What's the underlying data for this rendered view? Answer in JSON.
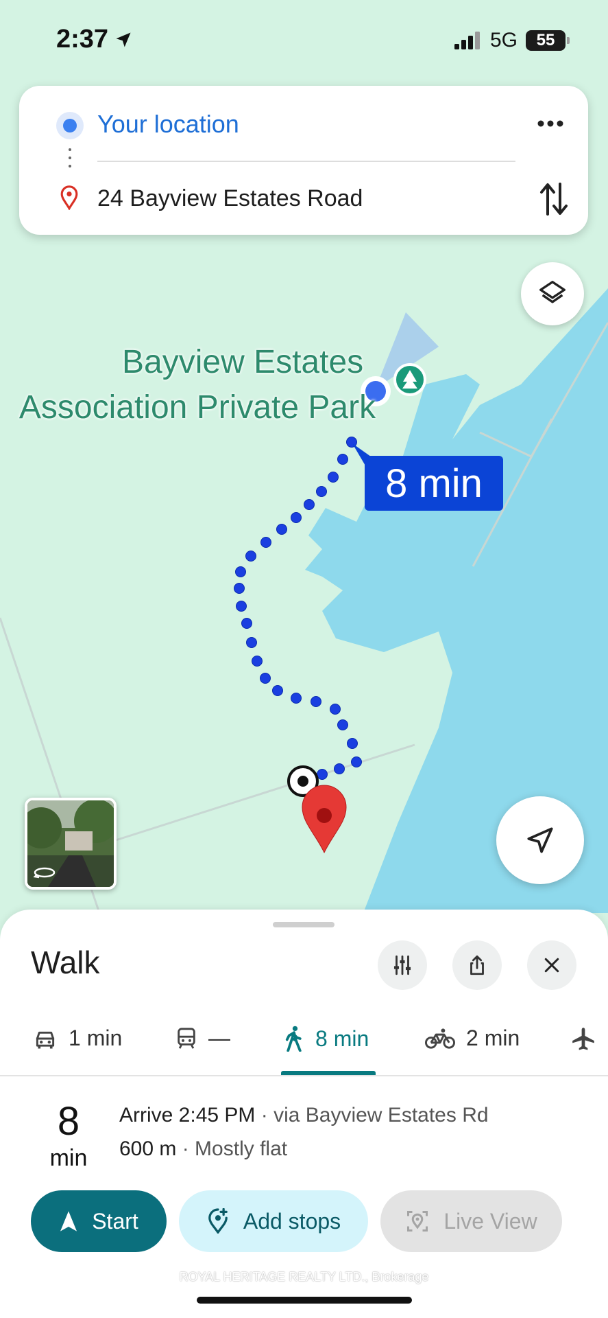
{
  "status_bar": {
    "time": "2:37",
    "network": "5G",
    "battery": "55",
    "icons": [
      "location-arrow-icon",
      "signal-bars-icon",
      "battery-icon"
    ]
  },
  "directions": {
    "origin": "Your location",
    "destination": "24 Bayview Estates Road",
    "more_icon": "more-horizontal-icon",
    "swap_icon": "swap-vertical-icon"
  },
  "map": {
    "park_label_line1": "Bayview Estates",
    "park_label_line2": "Association Private Park",
    "duration_chip": "8 min",
    "colors": {
      "land": "#d4f3e3",
      "water": "#8ed9ec",
      "route": "#1a3fe0",
      "park_label": "#2d8a6c",
      "dest_pin": "#e53935"
    }
  },
  "sheet": {
    "title": "Walk",
    "modes": [
      {
        "icon": "car-icon",
        "label": "1 min"
      },
      {
        "icon": "transit-icon",
        "label": "—"
      },
      {
        "icon": "walk-icon",
        "label": "8 min",
        "active": true
      },
      {
        "icon": "bike-icon",
        "label": "2 min"
      },
      {
        "icon": "plane-icon",
        "label": ""
      }
    ],
    "route": {
      "duration_value": "8",
      "duration_unit": "min",
      "arrive": "Arrive 2:45 PM",
      "via": "· via Bayview Estates Rd",
      "distance": "600 m",
      "terrain": "· Mostly flat"
    },
    "buttons": {
      "start": "Start",
      "add_stops": "Add stops",
      "live_view": "Live View"
    },
    "accent_color": "#0b6f7d"
  },
  "watermark": "ROYAL HERITAGE REALTY LTD., Brokerage"
}
